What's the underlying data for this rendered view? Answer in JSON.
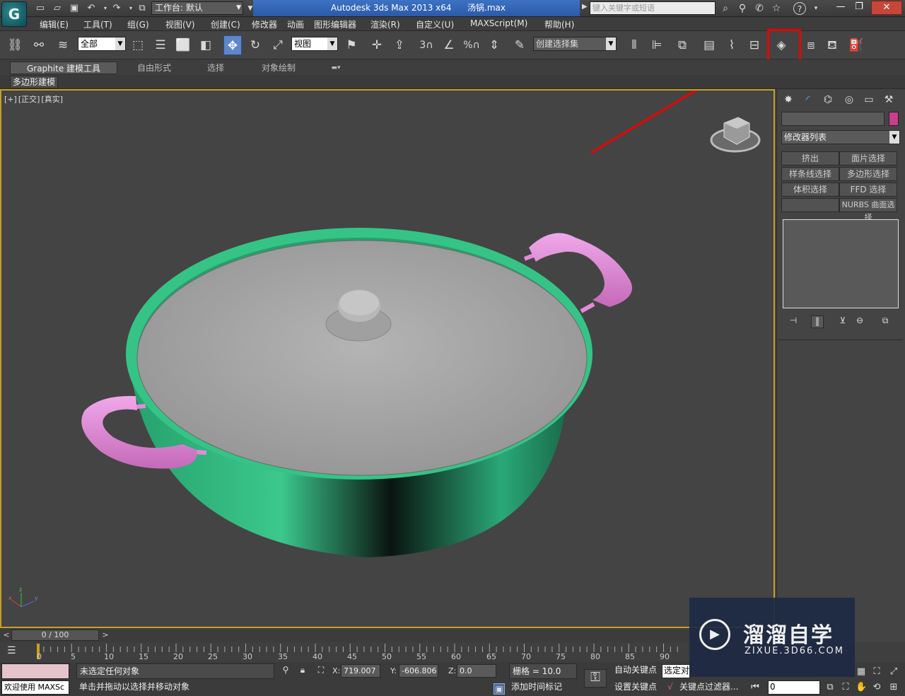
{
  "titlebar": {
    "workspace_label": "工作台: 默认",
    "app_title": "Autodesk 3ds Max  2013 x64",
    "file_name": "汤锅.max",
    "search_placeholder": "键入关键字或短语",
    "help_symbol": "?"
  },
  "menu": [
    "编辑(E)",
    "工具(T)",
    "组(G)",
    "视图(V)",
    "创建(C)",
    "修改器",
    "动画",
    "图形编辑器",
    "渲染(R)",
    "自定义(U)",
    "MAXScript(M)",
    "帮助(H)"
  ],
  "toolbar": {
    "selection_filter": "全部",
    "ref_coord": "视图",
    "named_selection": "创建选择集",
    "snap_3": "3",
    "percent_snap": "%"
  },
  "ribbon": {
    "tabs": [
      "Graphite 建模工具",
      "自由形式",
      "选择",
      "对象绘制"
    ],
    "sub_label": "多边形建模"
  },
  "viewport": {
    "labels": [
      "[+]",
      "[正交]",
      "[真实]"
    ],
    "axis_labels": [
      "z",
      "x",
      "y"
    ],
    "scene_colors": {
      "pot_body": "#2fae7a",
      "lid": "#a8a8a8",
      "handles": "#e58ad8",
      "background": "#444444"
    }
  },
  "command_panel": {
    "modifier_list": "修改器列表",
    "buttons": [
      "挤出",
      "面片选择",
      "样条线选择",
      "多边形选择",
      "体积选择",
      "FFD 选择",
      "",
      "NURBS 曲面选择"
    ],
    "object_color": "#c93f8d"
  },
  "timeline": {
    "frame_display": "0 / 100",
    "ticks": [
      "0",
      "5",
      "10",
      "15",
      "20",
      "25",
      "30",
      "35",
      "40",
      "45",
      "50",
      "55",
      "60",
      "65",
      "70",
      "75",
      "80",
      "85",
      "90"
    ]
  },
  "status": {
    "welcome": "欢迎使用 MAXSc",
    "selection_text": "未选定任何对象",
    "prompt_text": "单击并拖动以选择并移动对象",
    "x_label": "X:",
    "x_value": "719.007",
    "y_label": "Y:",
    "y_value": "-606.806",
    "z_label": "Z:",
    "z_value": "0.0",
    "grid": "栅格 = 10.0",
    "add_time_tag": "添加时间标记",
    "auto_key": "自动关键点",
    "set_key": "设置关键点",
    "selected_dropdown": "选定对",
    "key_filter": "关键点过滤器...",
    "frame_input": "0"
  },
  "watermark": {
    "text_cn": "溜溜自学",
    "text_en": "ZIXUE.3D66.COM"
  }
}
